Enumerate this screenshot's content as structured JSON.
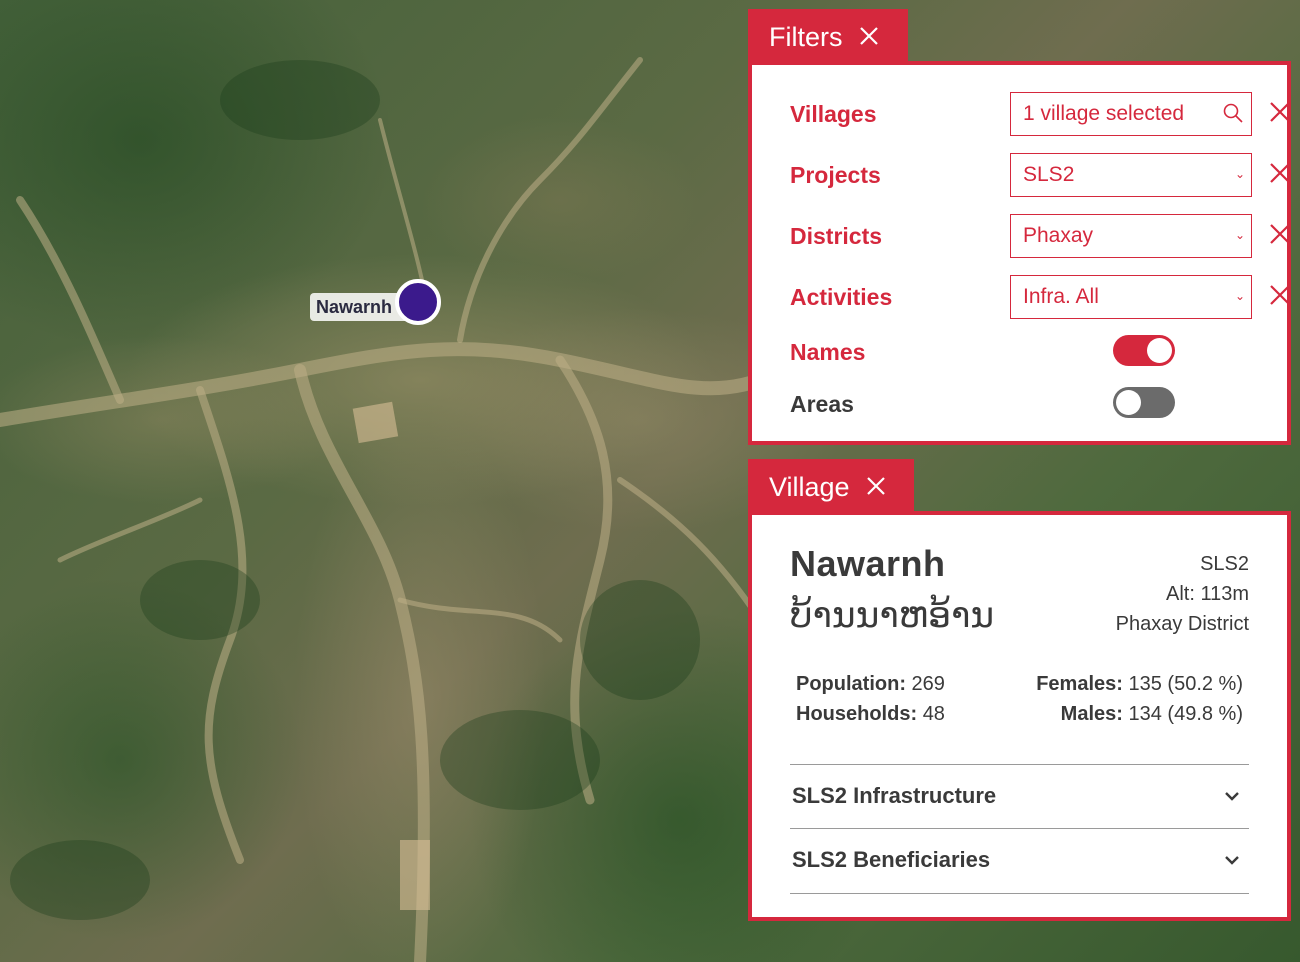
{
  "map": {
    "marker": {
      "label": "Nawarnh",
      "color": "#3b1a8c"
    }
  },
  "filters": {
    "title": "Filters",
    "close_icon": "close-icon",
    "rows": [
      {
        "label": "Villages",
        "value": "1 village selected",
        "kind": "search"
      },
      {
        "label": "Projects",
        "value": "SLS2",
        "kind": "select"
      },
      {
        "label": "Districts",
        "value": "Phaxay",
        "kind": "select"
      },
      {
        "label": "Activities",
        "value": "Infra. All",
        "kind": "select"
      }
    ],
    "toggles": [
      {
        "label": "Names",
        "on": true
      },
      {
        "label": "Areas",
        "on": false
      }
    ],
    "accent": "#d5283d"
  },
  "village": {
    "title": "Village",
    "name": "Nawarnh",
    "name_lao": "ບ້ານນາຫອ້ານ",
    "project": "SLS2",
    "altitude": "Alt: 113m",
    "district": "Phaxay District",
    "population_label": "Population:",
    "population": "269",
    "households_label": "Households:",
    "households": "48",
    "females_label": "Females:",
    "females": "135 (50.2 %)",
    "males_label": "Males:",
    "males": "134 (49.8 %)",
    "sections": [
      "SLS2 Infrastructure",
      "SLS2 Beneficiaries"
    ]
  }
}
